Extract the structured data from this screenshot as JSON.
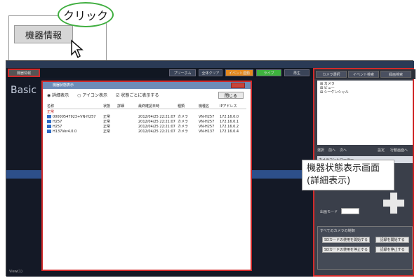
{
  "callout": {
    "button_label": "機器情報",
    "click_label": "クリック"
  },
  "app": {
    "toolbar_button": "機器情報",
    "basic_label": "Basic",
    "toolbar": [
      "プリーホム",
      "全体クリア",
      "イベント連動",
      "ライブ",
      "再生"
    ],
    "right_tabs": [
      "カメラ選択",
      "イベント検索",
      "録画検索"
    ],
    "tree_items": [
      "カメラ",
      "ビュー",
      "シーケンシャル"
    ],
    "right_buttons": [
      "選択",
      "前へ",
      "次へ",
      "設定",
      "行動画面へ"
    ],
    "ctrl_label": "カメラコントローラー",
    "focus_label": "出画モード",
    "section_title": "すべてのカメラの制御",
    "section_buttons": [
      "SDカードの使用を開始する",
      "記録を開始する",
      "SDカードの使用を停止する",
      "記録を停止する"
    ],
    "view_label": "View(1)"
  },
  "dialog": {
    "title": "機器状態表示",
    "option_detail": "詳細表示",
    "option_icon": "アイコン表示",
    "option_check": "状態ごとに表示する",
    "close_label": "閉じる",
    "columns": [
      "名称",
      "状態",
      "詳細",
      "最終確認日時",
      "種類",
      "機種名",
      "IPアドレス"
    ],
    "group": "正常",
    "rows": [
      [
        "00000547923+VN-H257",
        "正常",
        "",
        "2012/04/25 22:21:07",
        "カメラ",
        "VN-H257",
        "172.16.0.0"
      ],
      [
        "H257",
        "正常",
        "",
        "2012/04/25 22:21:07",
        "カメラ",
        "VN-H257",
        "172.16.0.1"
      ],
      [
        "H257",
        "正常",
        "",
        "2012/04/25 22:21:07",
        "カメラ",
        "VN-H257",
        "172.16.0.2"
      ],
      [
        "H137Ver4.0.0",
        "正常",
        "",
        "2012/04/25 22:21:07",
        "カメラ",
        "VN-H137",
        "172.16.0.4"
      ]
    ]
  },
  "annotation": {
    "line1": "機器状態表示画面",
    "line2": "(詳細表示)"
  }
}
